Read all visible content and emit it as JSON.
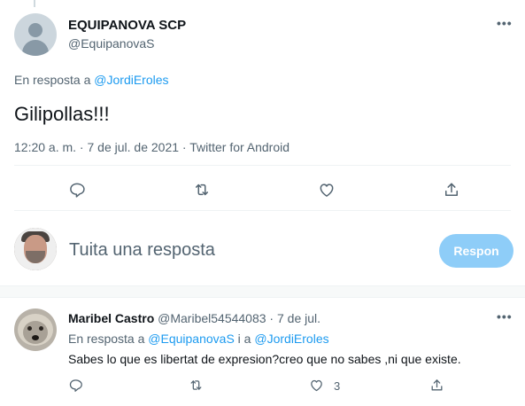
{
  "main_tweet": {
    "author_name": "EQUIPANOVA SCP",
    "author_handle": "@EquipanovaS",
    "more_label": "•••",
    "reply_prefix": "En resposta a ",
    "reply_mention": "@JordiEroles",
    "text": "Gilipollas!!!",
    "meta": "12:20 a. m. · 7 de jul. de 2021 · Twitter for Android",
    "actions": [
      {
        "name": "reply",
        "icon": "reply-icon"
      },
      {
        "name": "retweet",
        "icon": "retweet-icon"
      },
      {
        "name": "like",
        "icon": "heart-icon"
      },
      {
        "name": "share",
        "icon": "share-icon"
      }
    ]
  },
  "compose": {
    "placeholder": "Tuita una resposta",
    "button_label": "Respon"
  },
  "reply_tweet": {
    "author_name": "Maribel Castro",
    "author_handle": "@Maribel54544083",
    "separator": " · ",
    "date": "7 de jul.",
    "more_label": "•••",
    "reply_prefix": "En resposta a ",
    "mention_1": "@EquipanovaS",
    "joiner": " i a ",
    "mention_2": "@JordiEroles",
    "text": "Sabes lo que es libertat de expresion?creo que no sabes ,ni que existe.",
    "like_count": "3"
  },
  "colors": {
    "accent": "#1d9bf0",
    "secondary_text": "#536471",
    "button_disabled": "#8ecdf8"
  }
}
